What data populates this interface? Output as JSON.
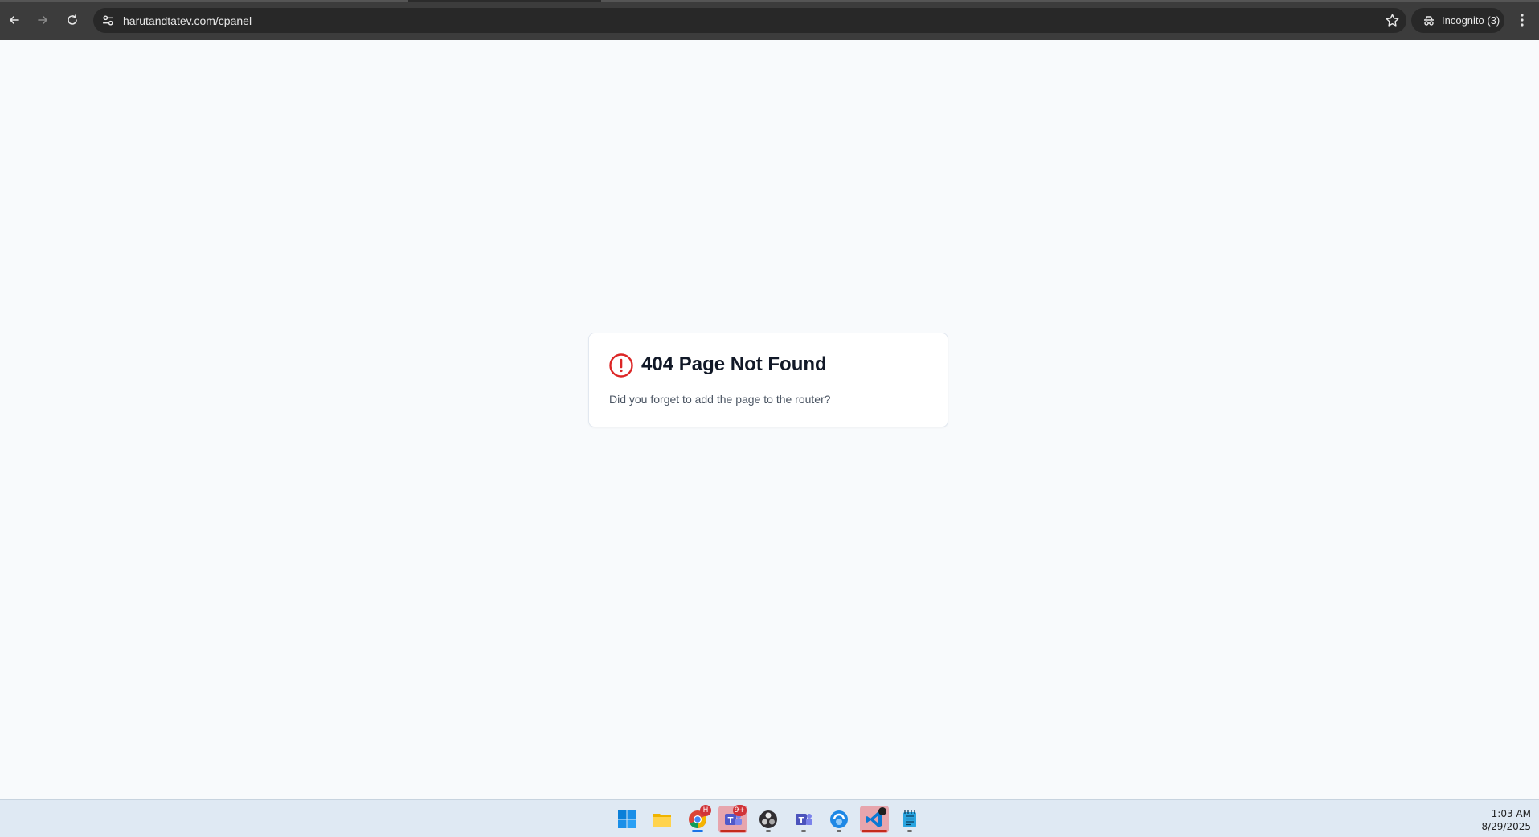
{
  "browser": {
    "url": "harutandtatev.com/cpanel",
    "incognito_label": "Incognito (3)",
    "icons": {
      "back": "arrow-left-icon",
      "forward": "arrow-right-icon",
      "reload": "reload-icon",
      "site_info": "tune-icon",
      "bookmark": "star-icon",
      "incognito": "incognito-icon",
      "menu": "kebab-menu-icon"
    }
  },
  "page": {
    "title": "404 Page Not Found",
    "message": "Did you forget to add the page to the router?",
    "alert_color": "#dc2626"
  },
  "taskbar": {
    "apps": [
      {
        "name": "start",
        "icon": "windows-start-icon"
      },
      {
        "name": "file-explorer",
        "icon": "folder-icon"
      },
      {
        "name": "chrome",
        "icon": "chrome-icon",
        "badge": "H"
      },
      {
        "name": "teams-red",
        "icon": "teams-icon",
        "badge": "9+"
      },
      {
        "name": "obs",
        "icon": "obs-icon"
      },
      {
        "name": "teams",
        "icon": "teams-icon"
      },
      {
        "name": "edge-app",
        "icon": "phone-app-icon"
      },
      {
        "name": "vscode",
        "icon": "vscode-icon"
      },
      {
        "name": "notepad",
        "icon": "notepad-icon"
      }
    ],
    "time": "1:03 AM",
    "date": "8/29/2025"
  }
}
